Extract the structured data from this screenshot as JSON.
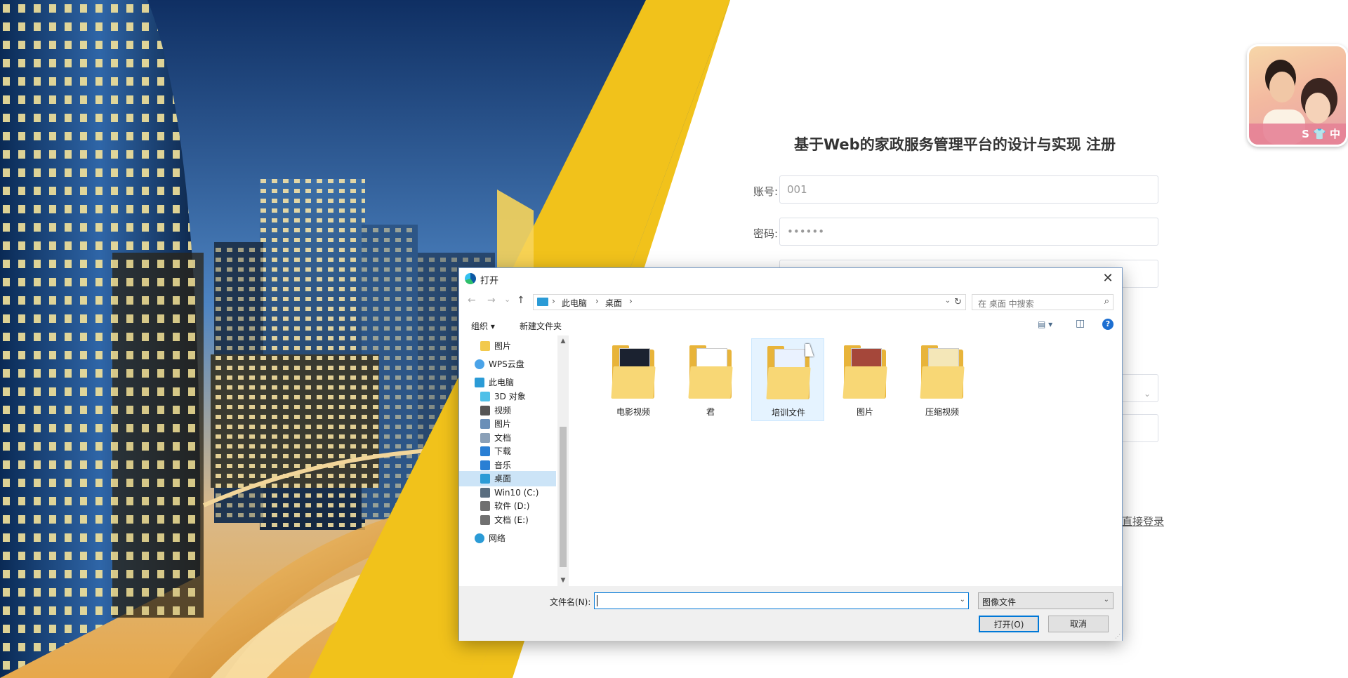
{
  "register": {
    "title": "基于Web的家政服务管理平台的设计与实现 注册",
    "account_label": "账号:",
    "account_value": "001",
    "password_label": "密码:",
    "password_value": "••••••",
    "login_link": "直接登录"
  },
  "avatar": {
    "bar_text": "S 👕 中"
  },
  "dialog": {
    "title": "打开",
    "close": "✕",
    "nav": {
      "back": "←",
      "forward": "→",
      "recent": "⌄",
      "up": "↑"
    },
    "breadcrumb": [
      "此电脑",
      "桌面"
    ],
    "separator": "›",
    "address_dropdown": "⌄",
    "refresh": "↻",
    "search_placeholder": "在 桌面 中搜索",
    "search_icon": "⌕",
    "toolbar": {
      "organize": "组织 ▾",
      "new_folder": "新建文件夹",
      "view_icon": "▤ ▾",
      "preview_icon": "◫",
      "help": "?"
    },
    "nav_pane": [
      {
        "label": "图片",
        "icon": "folder-icon",
        "color": "#f2c94c",
        "indent": 1
      },
      {
        "label": "WPS云盘",
        "icon": "cloud-icon",
        "color": "#4aa3e8",
        "indent": 0
      },
      {
        "label": "此电脑",
        "icon": "computer-icon",
        "color": "#2b9bd6",
        "indent": 0
      },
      {
        "label": "3D 对象",
        "icon": "cube-icon",
        "color": "#4fc0e8",
        "indent": 1
      },
      {
        "label": "视频",
        "icon": "video-icon",
        "color": "#555555",
        "indent": 1
      },
      {
        "label": "图片",
        "icon": "picture-icon",
        "color": "#6a8fb8",
        "indent": 1
      },
      {
        "label": "文档",
        "icon": "document-icon",
        "color": "#8aa0b8",
        "indent": 1
      },
      {
        "label": "下载",
        "icon": "download-icon",
        "color": "#2a7fd4",
        "indent": 1
      },
      {
        "label": "音乐",
        "icon": "music-icon",
        "color": "#2a7fd4",
        "indent": 1
      },
      {
        "label": "桌面",
        "icon": "desktop-icon",
        "color": "#2b9bd6",
        "indent": 1,
        "active": true
      },
      {
        "label": "Win10 (C:)",
        "icon": "drive-c-icon",
        "color": "#5a6e80",
        "indent": 1
      },
      {
        "label": "软件 (D:)",
        "icon": "drive-icon",
        "color": "#707070",
        "indent": 1
      },
      {
        "label": "文档 (E:)",
        "icon": "drive-icon",
        "color": "#707070",
        "indent": 1
      },
      {
        "label": "网络",
        "icon": "network-icon",
        "color": "#2b9bd6",
        "indent": 0
      }
    ],
    "scroll_up": "▲",
    "scroll_down": "▼",
    "files": [
      {
        "name": "电影视频",
        "paper": "#1b2230"
      },
      {
        "name": "君",
        "paper": "#ffffff"
      },
      {
        "name": "培训文件",
        "paper": "#eaf2ff",
        "selected": true
      },
      {
        "name": "图片",
        "paper": "#a5473a"
      },
      {
        "name": "压缩视频",
        "paper": "#f4e7b8"
      }
    ],
    "filename_label": "文件名(N):",
    "filename_value": "",
    "filename_dropdown": "⌄",
    "filetype": "图像文件",
    "filetype_dropdown": "⌄",
    "open_button": "打开(O)",
    "cancel_button": "取消",
    "grip": "⋰"
  }
}
